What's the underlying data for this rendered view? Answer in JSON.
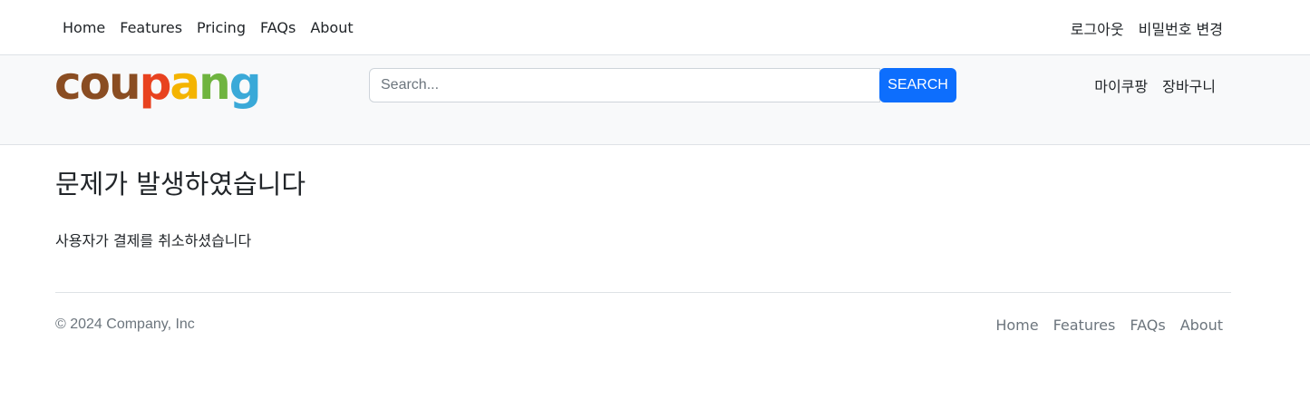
{
  "topnav": {
    "left_links": [
      "Home",
      "Features",
      "Pricing",
      "FAQs",
      "About"
    ],
    "right_links": [
      "로그아웃",
      "비밀번호 변경"
    ]
  },
  "header": {
    "logo": {
      "letters": [
        "c",
        "o",
        "u",
        "p",
        "a",
        "n",
        "g"
      ],
      "colors": [
        "#8a4d22",
        "#8a4d22",
        "#8a4d22",
        "#e8421f",
        "#f4b400",
        "#6fb43f",
        "#3aa9d8"
      ]
    },
    "search": {
      "placeholder": "Search...",
      "button_label": "SEARCH",
      "button_color": "#0d6efd"
    },
    "right_links": [
      "마이쿠팡",
      "장바구니"
    ]
  },
  "main": {
    "title": "문제가 발생하였습니다",
    "message": "사용자가 결제를 취소하셨습니다"
  },
  "footer": {
    "copyright": "© 2024 Company, Inc",
    "links": [
      "Home",
      "Features",
      "FAQs",
      "About"
    ]
  }
}
